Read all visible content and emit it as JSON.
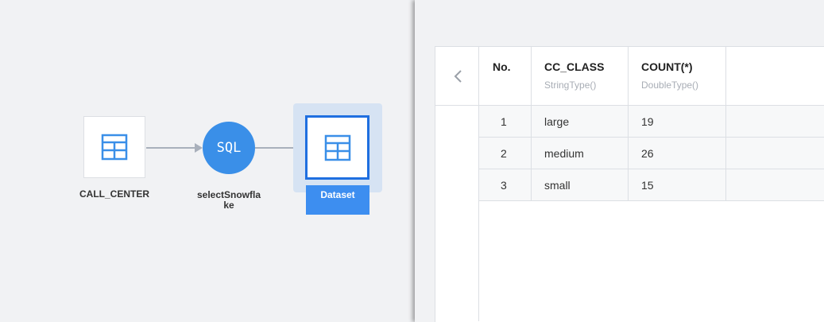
{
  "flow": {
    "source_node": {
      "label": "CALL_CENTER",
      "icon": "table-icon"
    },
    "sql_node": {
      "badge": "SQL",
      "label_line1": "selectSnowfla",
      "label_line2": "ke"
    },
    "dataset_node": {
      "label": "Dataset",
      "icon": "table-icon"
    }
  },
  "preview": {
    "back_icon": "chevron-left-icon",
    "columns": [
      {
        "name": "No.",
        "type": ""
      },
      {
        "name": "CC_CLASS",
        "type": "StringType()"
      },
      {
        "name": "COUNT(*)",
        "type": "DoubleType()"
      }
    ],
    "rows": [
      {
        "no": "1",
        "cc_class": "large",
        "count": "19"
      },
      {
        "no": "2",
        "cc_class": "medium",
        "count": "26"
      },
      {
        "no": "3",
        "cc_class": "small",
        "count": "15"
      }
    ]
  },
  "colors": {
    "accent": "#3a8fe8",
    "selected_border": "#1f6fe0",
    "selected_bg": "#d6e3f3",
    "connector": "#a9b0bb"
  }
}
